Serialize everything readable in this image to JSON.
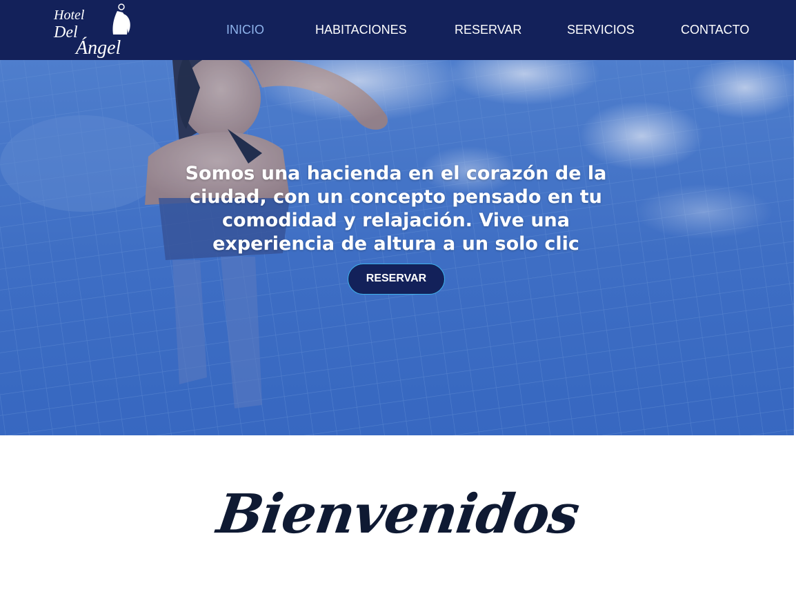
{
  "brand": {
    "logo_text_line1": "Hotel",
    "logo_text_line2": "Del",
    "logo_text_line3": "Ángel",
    "logo_icon": "angel-icon"
  },
  "nav": {
    "items": [
      {
        "label": "INICIO",
        "active": true
      },
      {
        "label": "HABITACIONES",
        "active": false
      },
      {
        "label": "RESERVAR",
        "active": false
      },
      {
        "label": "SERVICIOS",
        "active": false
      },
      {
        "label": "CONTACTO",
        "active": false
      }
    ]
  },
  "hero": {
    "headline": "Somos una hacienda en el corazón de la ciudad, con un concepto pensado en tu comodidad y relajación. Vive una experiencia de altura a un solo clic",
    "button_label": "RESERVAR"
  },
  "welcome": {
    "title": "Bienvenidos"
  },
  "colors": {
    "navbar_bg": "#13215a",
    "nav_active": "#8fb4ec",
    "button_border": "#3fb3ec",
    "pool_blue": "#3a6fc6",
    "title_color": "#0f1a33"
  }
}
